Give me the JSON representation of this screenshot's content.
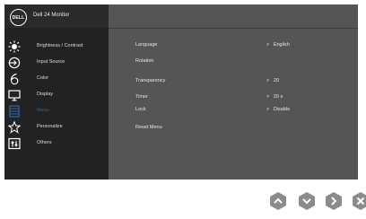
{
  "header": {
    "logo_text": "DELL",
    "monitor_title": "Dell 24 Monitor"
  },
  "menu": {
    "items": [
      {
        "label": "Brightness / Contrast",
        "icon": "brightness-icon"
      },
      {
        "label": "Input Source",
        "icon": "input-source-icon"
      },
      {
        "label": "Color",
        "icon": "color-icon"
      },
      {
        "label": "Display",
        "icon": "display-icon"
      },
      {
        "label": "Menu",
        "icon": "menu-icon"
      },
      {
        "label": "Personalize",
        "icon": "star-icon"
      },
      {
        "label": "Others",
        "icon": "others-icon"
      }
    ],
    "active_item": "Menu"
  },
  "settings": {
    "language": {
      "label": "Language",
      "value": "English"
    },
    "rotation": {
      "label": "Rotation"
    },
    "transparency": {
      "label": "Transparency",
      "value": "20"
    },
    "timer": {
      "label": "Timer",
      "value": "20 s"
    },
    "lock": {
      "label": "Lock",
      "value": "Disable"
    },
    "reset": {
      "label": "Reset Menu"
    },
    "arrow": ">"
  },
  "nav_buttons": [
    "up-button",
    "down-button",
    "right-button",
    "close-button"
  ],
  "colors": {
    "sidebar_bg": "#222222",
    "content_bg": "#555555",
    "active_accent": "#2e63a5",
    "button_gray": "#8b8b8b"
  }
}
